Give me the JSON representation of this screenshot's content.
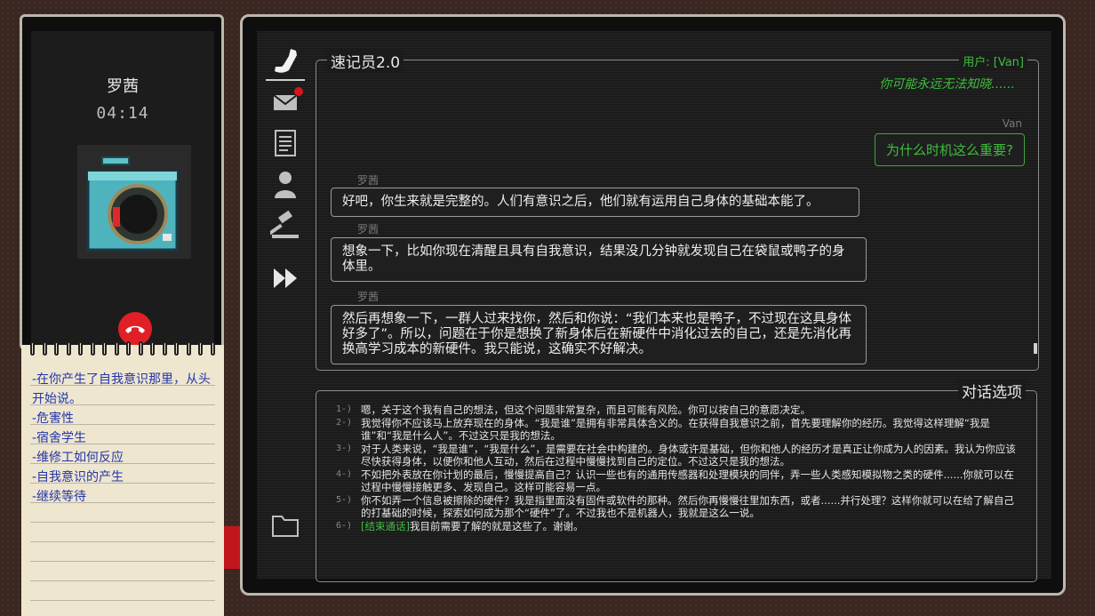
{
  "phone": {
    "caller_name": "罗茜",
    "call_timer": "04:14"
  },
  "notepad": {
    "items": [
      "-在你产生了自我意识那里，从头开始说。",
      "-危害性",
      "-宿舍学生",
      "-维修工如何反应",
      "-自我意识的产生",
      "-继续等待"
    ]
  },
  "chat": {
    "title": "速记员2.0",
    "user_tag": "用户: [Van]",
    "hint": "你可能永远无法知晓......",
    "reply_name": "Van",
    "reply_text": "为什么时机这么重要?",
    "messages": [
      {
        "name": "罗茜",
        "text": "好吧，你生来就是完整的。人们有意识之后，他们就有运用自己身体的基础本能了。"
      },
      {
        "name": "罗茜",
        "text": "想象一下，比如你现在清醒且具有自我意识，结果没几分钟就发现自己在袋鼠或鸭子的身体里。"
      },
      {
        "name": "罗茜",
        "text": "然后再想象一下，一群人过来找你，然后和你说：“我们本来也是鸭子，不过现在这具身体好多了”。所以，问题在于你是想换了新身体后在新硬件中消化过去的自己，还是先消化再换高学习成本的新硬件。我只能说，这确实不好解决。"
      }
    ]
  },
  "options": {
    "title": "对话选项",
    "items": [
      {
        "num": "1-)",
        "tag": "",
        "text": "嗯，关于这个我有自己的想法，但这个问题非常复杂，而且可能有风险。你可以按自己的意愿决定。"
      },
      {
        "num": "2-)",
        "tag": "",
        "text": "我觉得你不应该马上放弃现在的身体。“我是谁”是拥有非常具体含义的。在获得自我意识之前，首先要理解你的经历。我觉得这样理解“我是谁”和“我是什么人”。不过这只是我的想法。"
      },
      {
        "num": "3-)",
        "tag": "",
        "text": "对于人类来说，“我是谁”，“我是什么”，是需要在社会中构建的。身体或许是基础，但你和他人的经历才是真正让你成为人的因素。我认为你应该尽快获得身体，以便你和他人互动，然后在过程中慢慢找到自己的定位。不过这只是我的想法。"
      },
      {
        "num": "4-)",
        "tag": "",
        "text": "不如把外表放在你计划的最后，慢慢提高自己？认识一些也有的通用传感器和处理模块的同伴，弄一些人类感知模拟物之类的硬件......你就可以在过程中慢慢接触更多、发现自己。这样可能容易一点。"
      },
      {
        "num": "5-)",
        "tag": "",
        "text": "你不如弄一个信息被擦除的硬件？我是指里面没有固件或软件的那种。然后你再慢慢往里加东西，或者......并行处理？这样你就可以在给了解自己的打基础的时候，探索如何成为那个“硬件”了。不过我也不是机器人，我就是这么一说。"
      },
      {
        "num": "6-)",
        "tag": "[结束通话]",
        "text": "我目前需要了解的就是这些了。谢谢。"
      }
    ]
  },
  "nav": {
    "icons": [
      "phone-icon",
      "mail-icon",
      "document-icon",
      "person-icon",
      "gavel-icon",
      "fast-forward-icon",
      "folder-icon"
    ]
  },
  "colors": {
    "accent_green": "#3fbd3f",
    "hangup_red": "#e01f26",
    "note_blue": "#2236a8"
  }
}
